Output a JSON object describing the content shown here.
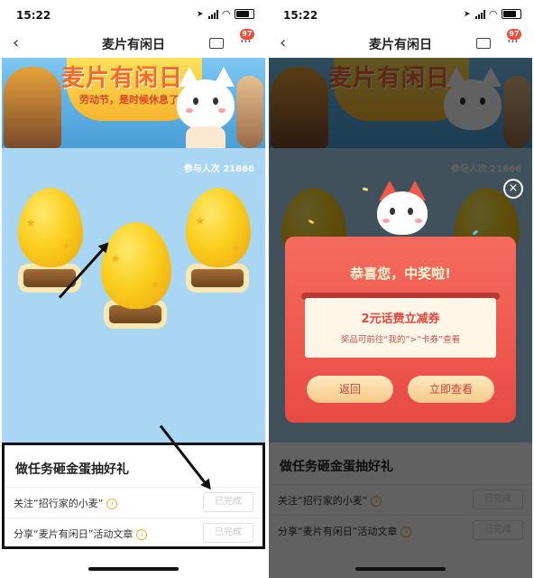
{
  "status": {
    "time": "15:22"
  },
  "nav": {
    "back": "‹",
    "title": "麦片有闲日",
    "more": "···",
    "badge": "97"
  },
  "banner": {
    "title": "麦片有闲日",
    "subtitle": "劳动节，是时候休息了"
  },
  "game": {
    "count_label": "参与人次 21866"
  },
  "tasks": {
    "heading": "做任务砸金蛋抽好礼",
    "items": [
      {
        "label": "关注“招行家的小麦”",
        "status": "已完成"
      },
      {
        "label": "分享“麦片有闲日”活动文章",
        "status": "已完成"
      }
    ]
  },
  "modal": {
    "title": "恭喜您，中奖啦!",
    "prize": "2元话费立减券",
    "prize_desc": "奖品可前往“我的”>“卡券”查看",
    "back_button": "返回",
    "view_button": "立即查看",
    "close": "×"
  },
  "colors": {
    "accent": "#e84a44",
    "gold": "#fbcf1f",
    "sky": "#a9d6f2",
    "button": "#f5c98a"
  }
}
